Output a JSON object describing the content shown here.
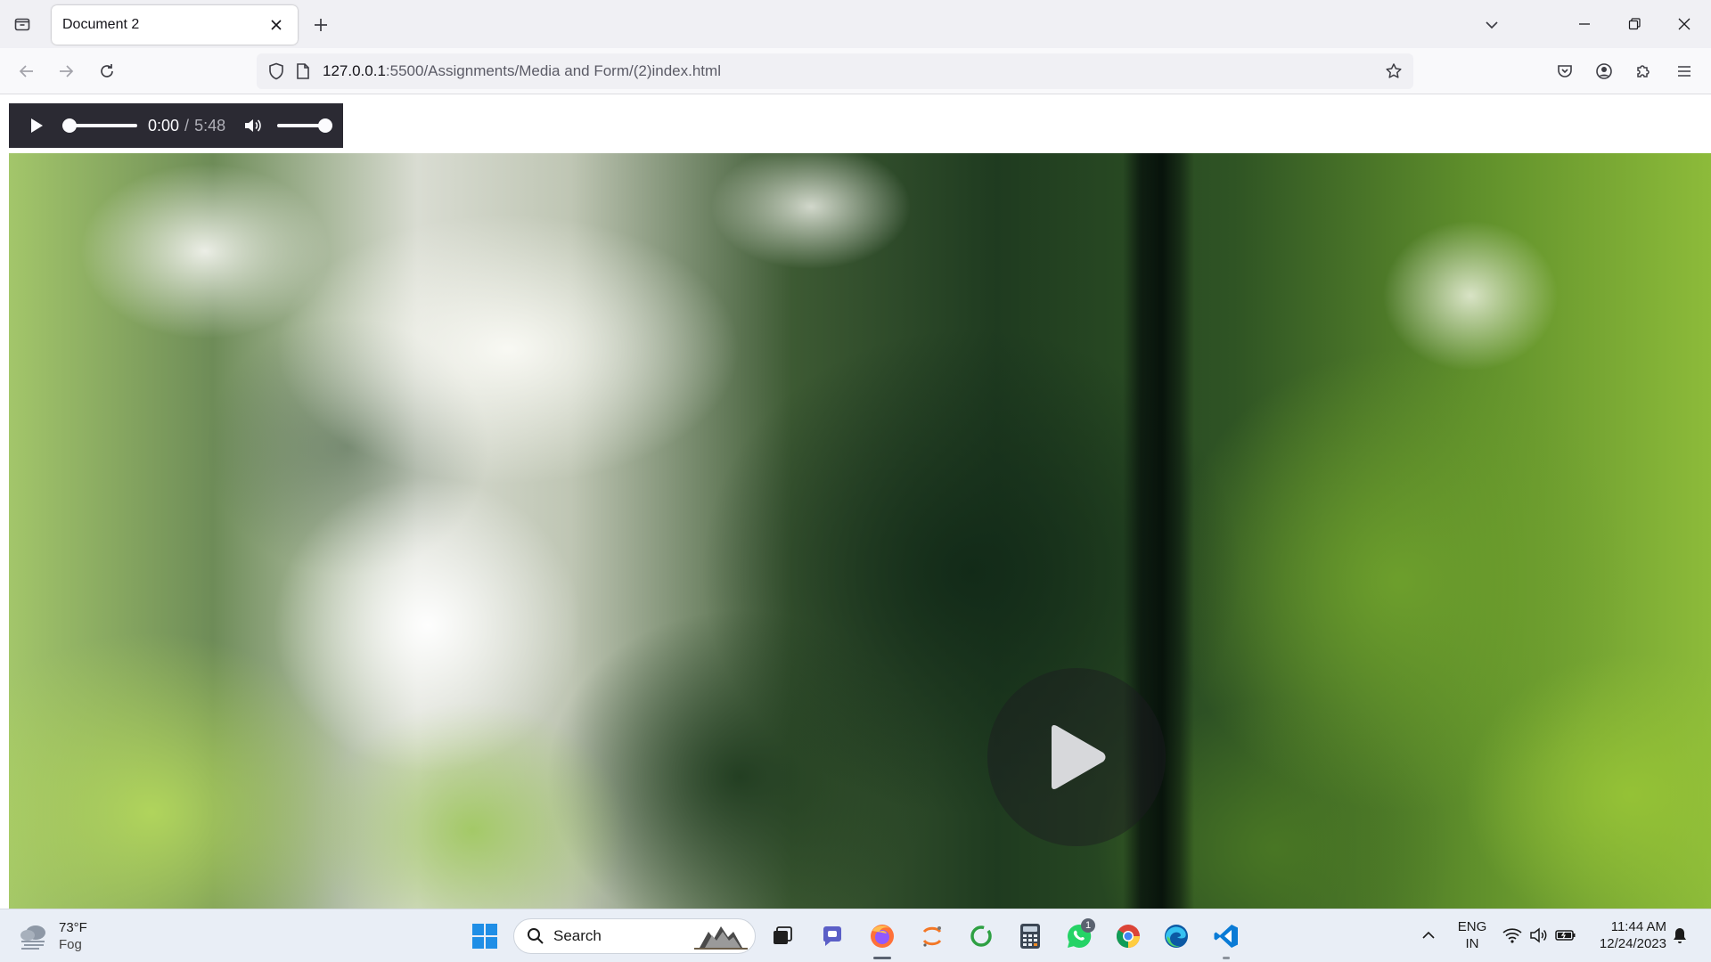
{
  "browser": {
    "tab": {
      "title": "Document 2"
    },
    "url": {
      "host": "127.0.0.1",
      "path": ":5500/Assignments/Media and Form/(2)index.html"
    }
  },
  "page": {
    "audio": {
      "current_time": "0:00",
      "separator": "/",
      "duration": "5:48",
      "progress": 0.0,
      "volume": 1.0
    },
    "video": {
      "state": "paused"
    }
  },
  "taskbar": {
    "weather": {
      "temp": "73°F",
      "condition": "Fog"
    },
    "search": {
      "placeholder": "Search"
    },
    "whatsapp_badge": "1",
    "lang": {
      "line1": "ENG",
      "line2": "IN"
    },
    "clock": {
      "time": "11:44 AM",
      "date": "12/24/2023"
    }
  },
  "colors": {
    "accent_edge": "#0078d4",
    "firefox": "#ff7139",
    "vscode": "#0a7bd6",
    "whatsapp": "#25d366"
  }
}
